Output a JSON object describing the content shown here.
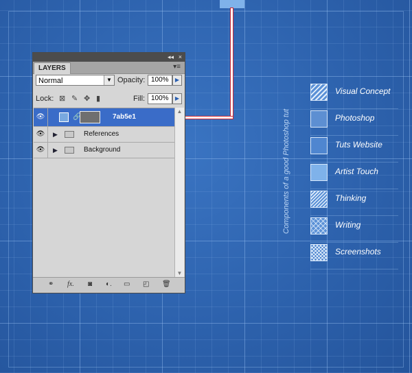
{
  "panel": {
    "tab_label": "LAYERS",
    "collapse_icon": "collapse-arrows-icon",
    "close_icon": "close-icon",
    "menu_icon": "panel-menu-icon",
    "blend_mode": "Normal",
    "opacity_label": "Opacity:",
    "opacity_value": "100%",
    "lock_label": "Lock:",
    "fill_label": "Fill:",
    "fill_value": "100%",
    "layers": [
      {
        "name": "7ab5e1",
        "selected": true,
        "type": "layer"
      },
      {
        "name": "References",
        "selected": false,
        "type": "group"
      },
      {
        "name": "Background",
        "selected": false,
        "type": "group"
      }
    ]
  },
  "legend": {
    "vertical_title": "Components of a good Photoshop tut",
    "items": [
      {
        "label": "Visual Concept",
        "swatch": "hatch-light"
      },
      {
        "label": "Photoshop",
        "swatch": "solid-mid"
      },
      {
        "label": "Tuts Website",
        "swatch": "solid-blue"
      },
      {
        "label": "Artist Touch",
        "swatch": "solid-light"
      },
      {
        "label": "Thinking",
        "swatch": "hatch-dense"
      },
      {
        "label": "Writing",
        "swatch": "crosshatch-light"
      },
      {
        "label": "Screenshots",
        "swatch": "crosshatch-dense"
      }
    ]
  },
  "colors": {
    "background": "#2d62ad",
    "selected_layer": "#3a6cc8",
    "swatch_color": "#7fb2ea",
    "connector_red": "#d0252f"
  }
}
